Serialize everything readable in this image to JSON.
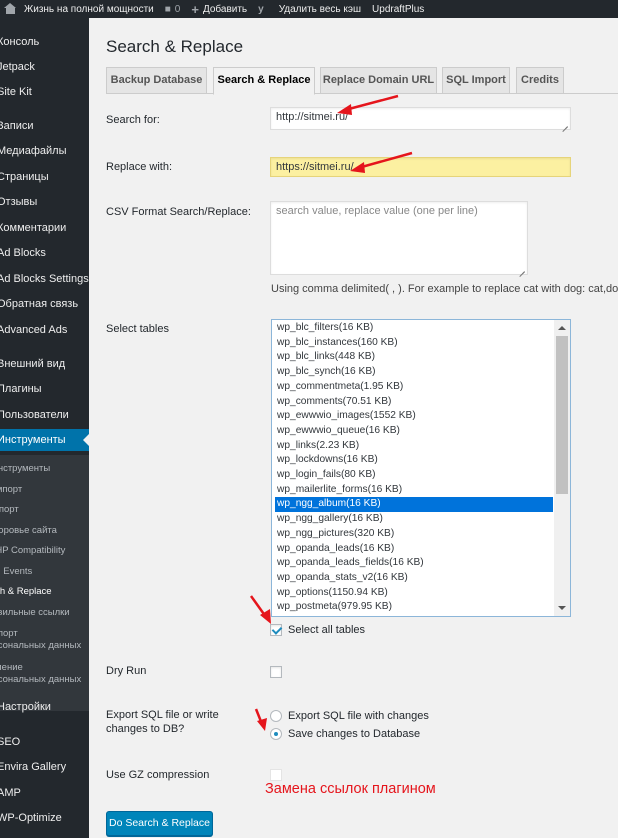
{
  "admin_bar": {
    "site_name": "Жизнь на полной мощности",
    "comments_count": "0",
    "add_new": "Добавить",
    "clear_cache": "Удалить весь кэш",
    "updraft": "UpdraftPlus"
  },
  "sidebar": {
    "items": [
      {
        "label": "Консоль"
      },
      {
        "label": "Jetpack"
      },
      {
        "label": "Site Kit"
      },
      {
        "label": "Записи"
      },
      {
        "label": "Медиафайлы"
      },
      {
        "label": "Страницы"
      },
      {
        "label": "Отзывы"
      },
      {
        "label": "Комментарии"
      },
      {
        "label": "Ad Blocks"
      },
      {
        "label": "Ad Blocks Settings"
      },
      {
        "label": "Обратная связь"
      },
      {
        "label": "Advanced Ads"
      },
      {
        "label": "Внешний вид"
      },
      {
        "label": "Плагины"
      },
      {
        "label": "Пользователи"
      },
      {
        "label": "Инструменты"
      },
      {
        "label": "Настройки"
      },
      {
        "label": "SEO"
      },
      {
        "label": "Envira Gallery"
      },
      {
        "label": "AMP"
      },
      {
        "label": "WP-Optimize"
      }
    ],
    "submenu": [
      {
        "label": "Инструменты"
      },
      {
        "label": "Импорт"
      },
      {
        "label": "Экспорт"
      },
      {
        "label": "Здоровье сайта"
      },
      {
        "label": "PHP Compatibility"
      },
      {
        "label": "Cron Events"
      },
      {
        "label": "Search & Replace"
      },
      {
        "label": "Правильные ссылки"
      },
      {
        "label": "Экспорт"
      },
      {
        "label": "персональных данных"
      },
      {
        "label": "Удаление"
      },
      {
        "label": "персональных данных"
      }
    ]
  },
  "page": {
    "title": "Search & Replace",
    "tabs": [
      {
        "label": "Backup Database"
      },
      {
        "label": "Search & Replace"
      },
      {
        "label": "Replace Domain URL"
      },
      {
        "label": "SQL Import"
      },
      {
        "label": "Credits"
      }
    ]
  },
  "form": {
    "search_label": "Search for:",
    "search_value": "http://sitmei.ru/",
    "replace_label": "Replace with:",
    "replace_value": "https://sitmei.ru/",
    "csv_label": "CSV Format Search/Replace:",
    "csv_placeholder": "search value, replace value (one per line)",
    "csv_hint": "Using comma delimited( , ). For example to replace cat with dog: cat,dog",
    "tables_label": "Select tables",
    "tables": [
      "wp_blc_filters(16 KB)",
      "wp_blc_instances(160 KB)",
      "wp_blc_links(448 KB)",
      "wp_blc_synch(16 KB)",
      "wp_commentmeta(1.95 KB)",
      "wp_comments(70.51 KB)",
      "wp_ewwwio_images(1552 KB)",
      "wp_ewwwio_queue(16 KB)",
      "wp_links(2.23 KB)",
      "wp_lockdowns(16 KB)",
      "wp_login_fails(80 KB)",
      "wp_mailerlite_forms(16 KB)",
      "wp_ngg_album(16 KB)",
      "wp_ngg_gallery(16 KB)",
      "wp_ngg_pictures(320 KB)",
      "wp_opanda_leads(16 KB)",
      "wp_opanda_leads_fields(16 KB)",
      "wp_opanda_stats_v2(16 KB)",
      "wp_options(1150.94 KB)",
      "wp_postmeta(979.95 KB)"
    ],
    "selected_table": "wp_ngg_album(16 KB)",
    "select_all_label": "Select all tables",
    "select_all_checked": true,
    "dry_run_label": "Dry Run",
    "dry_run_checked": false,
    "export_label_line1": "Export SQL file or write",
    "export_label_line2": "changes to DB?",
    "export_option_file": "Export SQL file with changes",
    "export_option_db": "Save changes to Database",
    "export_selected": "db",
    "gz_label": "Use GZ compression",
    "gz_checked": false,
    "submit_label": "Do Search & Replace"
  },
  "annotation": {
    "text": "Замена ссылок плагином",
    "color": "#e5151c"
  }
}
